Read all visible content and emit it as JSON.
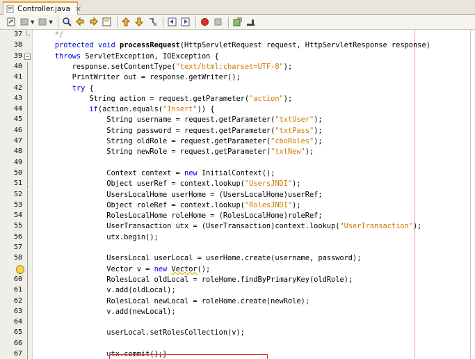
{
  "tab": {
    "title": "Controller.java",
    "close": "×"
  },
  "toolbar": {
    "buttons": [
      "last-edit-icon",
      "back-icon",
      "forward-icon",
      "find-icon",
      "find-previous-icon",
      "find-next-icon",
      "toggle-highlight-icon",
      "previous-bookmark-icon",
      "next-bookmark-icon",
      "toggle-bookmark-icon",
      "shift-left-icon",
      "shift-right-icon",
      "start-macro-icon",
      "stop-macro-icon",
      "comment-icon",
      "uncomment-icon"
    ]
  },
  "lines": [
    {
      "n": "37",
      "t": "    */"
    },
    {
      "n": "38",
      "t": "    protected void processRequest(HttpServletRequest request, HttpServletResponse response)"
    },
    {
      "n": "39",
      "t": "    throws ServletException, IOException {"
    },
    {
      "n": "40",
      "t": "        response.setContentType(\"text/html;charset=UTF-8\");"
    },
    {
      "n": "41",
      "t": "        PrintWriter out = response.getWriter();"
    },
    {
      "n": "42",
      "t": "        try {"
    },
    {
      "n": "43",
      "t": "            String action = request.getParameter(\"action\");"
    },
    {
      "n": "44",
      "t": "            if(action.equals(\"Insert\")) {"
    },
    {
      "n": "45",
      "t": "                String username = request.getParameter(\"txtUser\");"
    },
    {
      "n": "46",
      "t": "                String password = request.getParameter(\"txtPass\");"
    },
    {
      "n": "47",
      "t": "                String oldRole = request.getParameter(\"cboRoles\");"
    },
    {
      "n": "48",
      "t": "                String newRole = request.getParameter(\"txtNew\");"
    },
    {
      "n": "49",
      "t": ""
    },
    {
      "n": "50",
      "t": "                Context context = new InitialContext();"
    },
    {
      "n": "51",
      "t": "                Object userRef = context.lookup(\"UsersJNDI\");"
    },
    {
      "n": "52",
      "t": "                UsersLocalHome userHome = (UsersLocalHome)userRef;"
    },
    {
      "n": "53",
      "t": "                Object roleRef = context.lookup(\"RolesJNDI\");"
    },
    {
      "n": "54",
      "t": "                RolesLocalHome roleHome = (RolesLocalHome)roleRef;"
    },
    {
      "n": "55",
      "t": "                UserTransaction utx = (UserTransaction)context.lookup(\"UserTransaction\");"
    },
    {
      "n": "56",
      "t": "                utx.begin();"
    },
    {
      "n": "57",
      "t": ""
    },
    {
      "n": "58",
      "t": "                UsersLocal userLocal = userHome.create(username, password);"
    },
    {
      "n": "59",
      "t": "                Vector v = new Vector();"
    },
    {
      "n": "60",
      "t": "                RolesLocal oldLocal = roleHome.findByPrimaryKey(oldRole);"
    },
    {
      "n": "61",
      "t": "                v.add(oldLocal);"
    },
    {
      "n": "62",
      "t": "                RolesLocal newLocal = roleHome.create(newRole);"
    },
    {
      "n": "63",
      "t": "                v.add(newLocal);"
    },
    {
      "n": "64",
      "t": ""
    },
    {
      "n": "65",
      "t": "                userLocal.setRolesCollection(v);"
    },
    {
      "n": "66",
      "t": ""
    },
    {
      "n": "67",
      "t": "                utx.commit();}"
    }
  ],
  "colors": {
    "keyword": "#0000e6",
    "string": "#ce7b00",
    "highlight": "#e0302c",
    "margin": "#f3a0a0"
  }
}
